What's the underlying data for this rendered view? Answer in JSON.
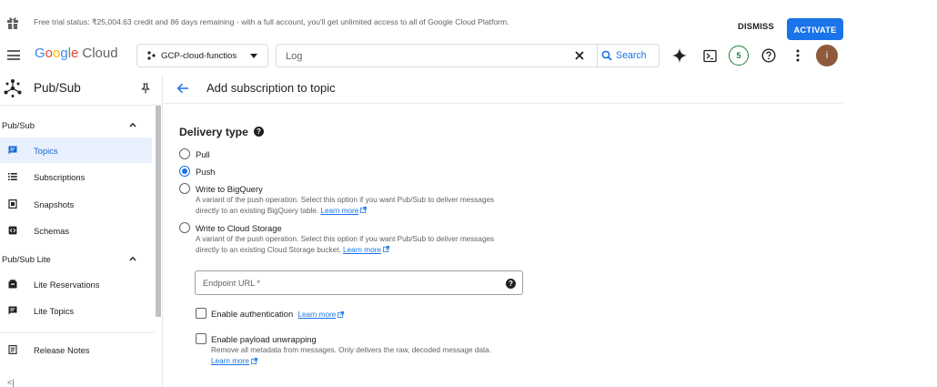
{
  "banner": {
    "message": "Free trial status: ₹25,004.63 credit and 86 days remaining - with a full account, you'll get unlimited access to all of Google Cloud Platform.",
    "dismiss_label": "DISMISS",
    "activate_label": "ACTIVATE"
  },
  "topbar": {
    "logo_letters": [
      "G",
      "o",
      "o",
      "g",
      "l",
      "e"
    ],
    "logo_suffix": "Cloud",
    "project_name": "GCP-cloud-functios",
    "search_placeholder": "Log",
    "search_button_label": "Search",
    "notifications_count": "5",
    "avatar_initial": "i"
  },
  "sidebar": {
    "product_title": "Pub/Sub",
    "sections": [
      {
        "label": "Pub/Sub",
        "items": [
          {
            "label": "Topics",
            "icon": "topics-icon",
            "active": true
          },
          {
            "label": "Subscriptions",
            "icon": "list-icon",
            "active": false
          },
          {
            "label": "Snapshots",
            "icon": "snapshot-icon",
            "active": false
          },
          {
            "label": "Schemas",
            "icon": "schema-icon",
            "active": false
          }
        ]
      },
      {
        "label": "Pub/Sub Lite",
        "items": [
          {
            "label": "Lite Reservations",
            "icon": "reservation-icon",
            "active": false
          },
          {
            "label": "Lite Topics",
            "icon": "topics-icon",
            "active": false
          }
        ]
      }
    ],
    "release_notes_label": "Release Notes",
    "collapse_label": "<|"
  },
  "main": {
    "page_title": "Add subscription to topic",
    "delivery_type": {
      "title": "Delivery type",
      "options": [
        {
          "label": "Pull",
          "selected": false
        },
        {
          "label": "Push",
          "selected": true
        },
        {
          "label": "Write to BigQuery",
          "selected": false,
          "desc1": "A variant of the push operation. Select this option if you want Pub/Sub to deliver messages",
          "desc2": "directly to an existing BigQuery table.",
          "link": "Learn more"
        },
        {
          "label": "Write to Cloud Storage",
          "selected": false,
          "desc1": "A variant of the push operation. Select this option if you want Pub/Sub to deliver messages",
          "desc2": "directly to an existing Cloud Storage bucket.",
          "link": "Learn more"
        }
      ]
    },
    "endpoint_placeholder": "Endpoint URL *",
    "enable_auth_label": "Enable authentication",
    "enable_auth_link": "Learn more",
    "payload_unwrap_label": "Enable payload unwrapping",
    "payload_unwrap_desc": "Remove all metadata from messages. Only delivers the raw, decoded message data.",
    "payload_unwrap_link": "Learn more"
  },
  "colors": {
    "accent": "#1a73e8",
    "active_bg": "#e8f0fe",
    "badge_green": "#188038",
    "avatar_bg": "#8d5a3b"
  }
}
